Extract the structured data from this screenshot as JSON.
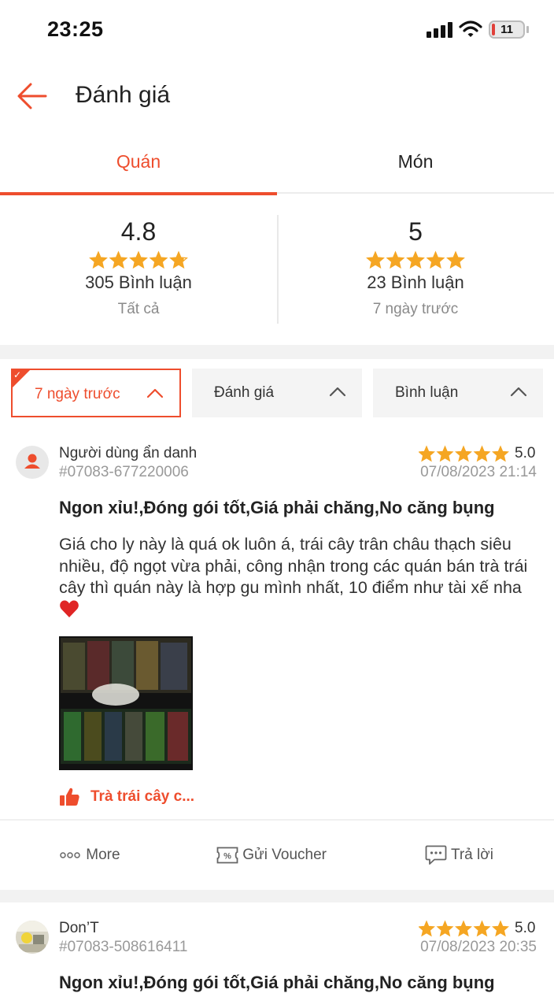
{
  "status_bar": {
    "time": "23:25",
    "battery": "11"
  },
  "header": {
    "title": "Đánh giá"
  },
  "tabs": [
    {
      "label": "Quán",
      "active": true
    },
    {
      "label": "Món",
      "active": false
    }
  ],
  "summary": [
    {
      "score": "4.8",
      "rating": 4.8,
      "count": "305 Bình luận",
      "label": "Tất cả"
    },
    {
      "score": "5",
      "rating": 5,
      "count": "23 Bình luận",
      "label": "7 ngày trước"
    }
  ],
  "filters": [
    {
      "label": "7 ngày trước",
      "active": true
    },
    {
      "label": "Đánh giá",
      "active": false
    },
    {
      "label": "Bình luận",
      "active": false
    }
  ],
  "reviews": [
    {
      "name": "Người dùng ẩn danh",
      "id": "#07083-677220006",
      "score": "5.0",
      "rating": 5,
      "date": "07/08/2023 21:14",
      "title": "Ngon xỉu!,Đóng gói tốt,Giá phải chăng,No căng bụng",
      "body": "Giá cho ly này là quá ok luôn á, trái cây trân châu thạch siêu nhiều, độ ngọt vừa phải, công nhận trong các quán bán trà trái cây thì quán này là hợp gu mình nhất, 10 điểm như tài xế nha",
      "liked_item": "Trà trái cây c..."
    },
    {
      "name": "Don’T",
      "id": "#07083-508616411",
      "score": "5.0",
      "rating": 5,
      "date": "07/08/2023 20:35",
      "title": "Ngon xỉu!,Đóng gói tốt,Giá phải chăng,No căng bụng"
    }
  ],
  "actions": {
    "more": "More",
    "voucher": "Gửi Voucher",
    "reply": "Trả lời"
  },
  "colors": {
    "accent": "#ee4d2d",
    "star": "#f5a623",
    "muted": "#999999",
    "band": "#f2f2f2"
  },
  "icons": [
    "back-arrow-icon",
    "star-icon",
    "chevron-up-icon",
    "thumbs-up-icon",
    "more-dots-icon",
    "voucher-icon",
    "chat-bubble-icon",
    "heart-icon",
    "check-icon"
  ]
}
